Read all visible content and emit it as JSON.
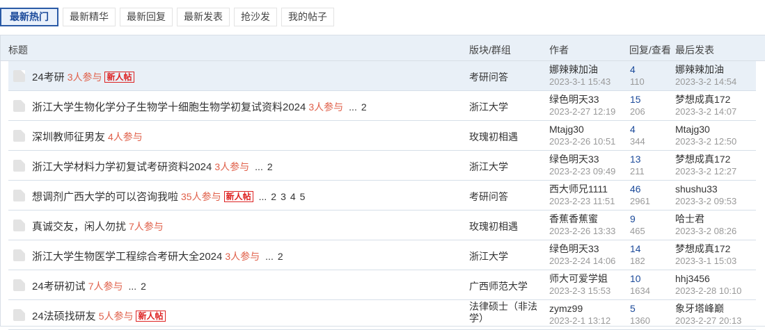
{
  "tabs": [
    "最新热门",
    "最新精华",
    "最新回复",
    "最新发表",
    "抢沙发",
    "我的帖子"
  ],
  "header": {
    "title": "标题",
    "forum": "版块/群组",
    "author": "作者",
    "replies": "回复/查看",
    "last": "最后发表"
  },
  "rows": [
    {
      "title": "24考研",
      "participants": "3人参与",
      "badge": "新人帖",
      "pages": [],
      "forum": "考研问答",
      "author": "娜辣辣加油",
      "author_time": "2023-3-1 15:43",
      "replies": "4",
      "views": "110",
      "last_user": "娜辣辣加油",
      "last_time": "2023-3-2 14:54"
    },
    {
      "title": "浙江大学生物化学分子生物学十细胞生物学初复试资料2024",
      "participants": "3人参与",
      "badge": "",
      "pages": [
        "...",
        "2"
      ],
      "forum": "浙江大学",
      "author": "绿色明天33",
      "author_time": "2023-2-27 12:19",
      "replies": "15",
      "views": "206",
      "last_user": "梦想成真172",
      "last_time": "2023-3-2 14:07"
    },
    {
      "title": "深圳教师征男友",
      "participants": "4人参与",
      "badge": "",
      "pages": [],
      "forum": "玫瑰初相遇",
      "author": "Mtajg30",
      "author_time": "2023-2-26 10:51",
      "replies": "4",
      "views": "344",
      "last_user": "Mtajg30",
      "last_time": "2023-3-2 12:50"
    },
    {
      "title": "浙江大学材料力学初复试考研资料2024",
      "participants": "3人参与",
      "badge": "",
      "pages": [
        "...",
        "2"
      ],
      "forum": "浙江大学",
      "author": "绿色明天33",
      "author_time": "2023-2-23 09:49",
      "replies": "13",
      "views": "211",
      "last_user": "梦想成真172",
      "last_time": "2023-3-2 12:27"
    },
    {
      "title": "想调剂广西大学的可以咨询我啦",
      "participants": "35人参与",
      "badge": "新人帖",
      "pages": [
        "...",
        "2",
        "3",
        "4",
        "5"
      ],
      "forum": "考研问答",
      "author": "西大师兄1111",
      "author_time": "2023-2-23 11:51",
      "replies": "46",
      "views": "2961",
      "last_user": "shushu33",
      "last_time": "2023-3-2 09:53"
    },
    {
      "title": "真诚交友，闲人勿扰",
      "participants": "7人参与",
      "badge": "",
      "pages": [],
      "forum": "玫瑰初相遇",
      "author": "香蕉香蕉蜜",
      "author_time": "2023-2-26 13:33",
      "replies": "9",
      "views": "465",
      "last_user": "哈士君",
      "last_time": "2023-3-2 08:26"
    },
    {
      "title": "浙江大学生物医学工程综合考研大全2024",
      "participants": "3人参与",
      "badge": "",
      "pages": [
        "...",
        "2"
      ],
      "forum": "浙江大学",
      "author": "绿色明天33",
      "author_time": "2023-2-24 14:06",
      "replies": "14",
      "views": "182",
      "last_user": "梦想成真172",
      "last_time": "2023-3-1 15:03"
    },
    {
      "title": "24考研初试",
      "participants": "7人参与",
      "badge": "",
      "pages": [
        "...",
        "2"
      ],
      "forum": "广西师范大学",
      "author": "师大可爱学姐",
      "author_time": "2023-2-3 15:53",
      "replies": "10",
      "views": "1634",
      "last_user": "hhj3456",
      "last_time": "2023-2-28 10:10"
    },
    {
      "title": "24法硕找研友",
      "participants": "5人参与",
      "badge": "新人帖",
      "pages": [],
      "forum": "法律硕士（非法学）",
      "author": "zymz99",
      "author_time": "2023-2-1 13:12",
      "replies": "5",
      "views": "1360",
      "last_user": "象牙塔峰巅",
      "last_time": "2023-2-27 20:13"
    }
  ]
}
